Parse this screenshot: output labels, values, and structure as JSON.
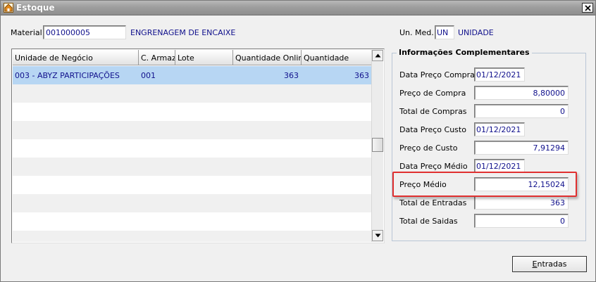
{
  "window": {
    "title": "Estoque"
  },
  "material": {
    "label": "Material",
    "code": "001000005",
    "description": "ENGRENAGEM DE ENCAIXE"
  },
  "unit": {
    "label": "Un. Med.",
    "code": "UN",
    "description": "UNIDADE"
  },
  "grid": {
    "columns": [
      "Unidade de Negócio",
      "C. Armaz.",
      "Lote",
      "Quantidade Online",
      "Quantidade"
    ],
    "rows": [
      {
        "unidade": "003 - ABYZ PARTICIPAÇÕES",
        "armaz": "001",
        "lote": "",
        "qtd_online": "363",
        "qtd": "363",
        "selected": true
      }
    ]
  },
  "info": {
    "title": "Informações Complementares",
    "fields": [
      {
        "label": "Data Preço Compra",
        "value": "01/12/2021",
        "kind": "date"
      },
      {
        "label": "Preço de Compra",
        "value": "8,80000",
        "kind": "num"
      },
      {
        "label": "Total de Compras",
        "value": "0",
        "kind": "num"
      },
      {
        "label": "Data Preço Custo",
        "value": "01/12/2021",
        "kind": "date"
      },
      {
        "label": "Preço de Custo",
        "value": "7,91294",
        "kind": "num"
      },
      {
        "label": "Data Preço Médio",
        "value": "01/12/2021",
        "kind": "date"
      },
      {
        "label": "Preço Médio",
        "value": "12,15024",
        "kind": "num",
        "highlighted": true
      },
      {
        "label": "Total de Entradas",
        "value": "363",
        "kind": "num"
      },
      {
        "label": "Total de Saidas",
        "value": "0",
        "kind": "num"
      }
    ]
  },
  "buttons": {
    "entradas_prefix": "E",
    "entradas_rest": "ntradas"
  },
  "colors": {
    "highlight_border": "#e03030",
    "selected_row": "#b7d6f3",
    "value_text": "#10108c"
  }
}
